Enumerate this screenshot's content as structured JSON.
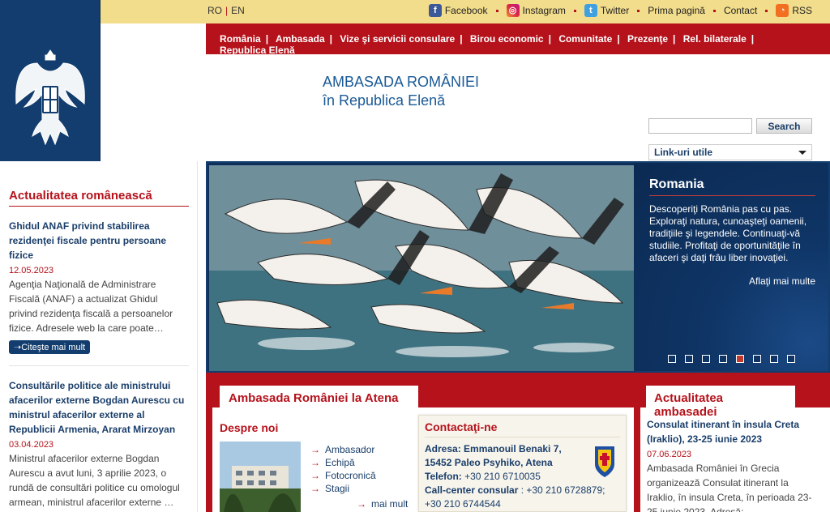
{
  "language": {
    "items": [
      "RO",
      "EN"
    ]
  },
  "social": {
    "facebook": "Facebook",
    "instagram": "Instagram",
    "twitter": "Twitter",
    "home": "Prima pagină",
    "contact": "Contact",
    "rss": "RSS"
  },
  "nav": {
    "items": [
      "România",
      "Ambasada",
      "Vize şi servicii consulare",
      "Birou economic",
      "Comunitate",
      "Prezenţe",
      "Rel. bilaterale",
      "Republica Elenă"
    ]
  },
  "header": {
    "title_line1": "AMBASADA ROMÂNIEI",
    "title_line2": "în Republica Elenă",
    "search_button": "Search",
    "links_select": "Link-uri utile"
  },
  "left": {
    "title": "Actualitatea românească",
    "news": [
      {
        "title": "Ghidul ANAF privind stabilirea rezidenţei fiscale pentru persoane fizice",
        "date": "12.05.2023",
        "text": "Agenţia Naţională de Administrare Fiscală (ANAF) a actualizat Ghidul privind rezidenţa fiscală a persoanelor fizice. Adresele web la care poate…",
        "more": "➝Citeşte mai mult"
      },
      {
        "title": "Consultările politice ale ministrului afacerilor externe Bogdan Aurescu cu ministrul afacerilor externe al Republicii Armenia, Ararat Mirzoyan",
        "date": "03.04.2023",
        "text": "Ministrul afacerilor externe Bogdan Aurescu a avut luni, 3 aprilie 2023, o rundă de consultări politice cu omologul armean, ministrul afacerilor externe …"
      }
    ]
  },
  "hero": {
    "title": "Romania",
    "text": "Descoperiţi România pas cu pas. Exploraţi natura, cunoaşteţi oamenii, tradiţiile şi legendele. Continuaţi-vă studiile. Profitaţi de oportunităţile în afaceri şi daţi frâu liber inovaţiei.",
    "cta": "Aflaţi mai multe",
    "slides": 8,
    "active_slide": 5
  },
  "main": {
    "tab": "Ambasada României la Atena",
    "about_title": "Despre noi",
    "about_links": [
      "Ambasador",
      "Echipă",
      "Fotocronică",
      "Stagii"
    ],
    "about_more": "mai mult",
    "contact": {
      "title": "Contactaţi-ne",
      "address_label": "Adresa:",
      "address_line1": "Emmanouil Benaki 7,",
      "address_line2": "15452 Paleo Psyhiko, Atena",
      "phone_label": "Telefon:",
      "phone": "+30 210 6710035",
      "callcenter_label": "Call-center consular",
      "callcenter": " : +30 210 6728879;",
      "callcenter2": "+30 210 6744544"
    }
  },
  "right": {
    "tab": "Actualitatea ambasadei",
    "news_title": "Consulat itinerant în insula Creta (Iraklio), 23-25 iunie 2023",
    "news_date": "07.06.2023",
    "news_text": "Ambasada României în Grecia organizează Consulat itinerant la Iraklio, în insula Creta, în perioada 23-25 iunie 2023. Adresă: …"
  },
  "colors": {
    "brand_red": "#b5121b",
    "brand_blue": "#123d6e",
    "top_yellow": "#f2dd8c"
  }
}
